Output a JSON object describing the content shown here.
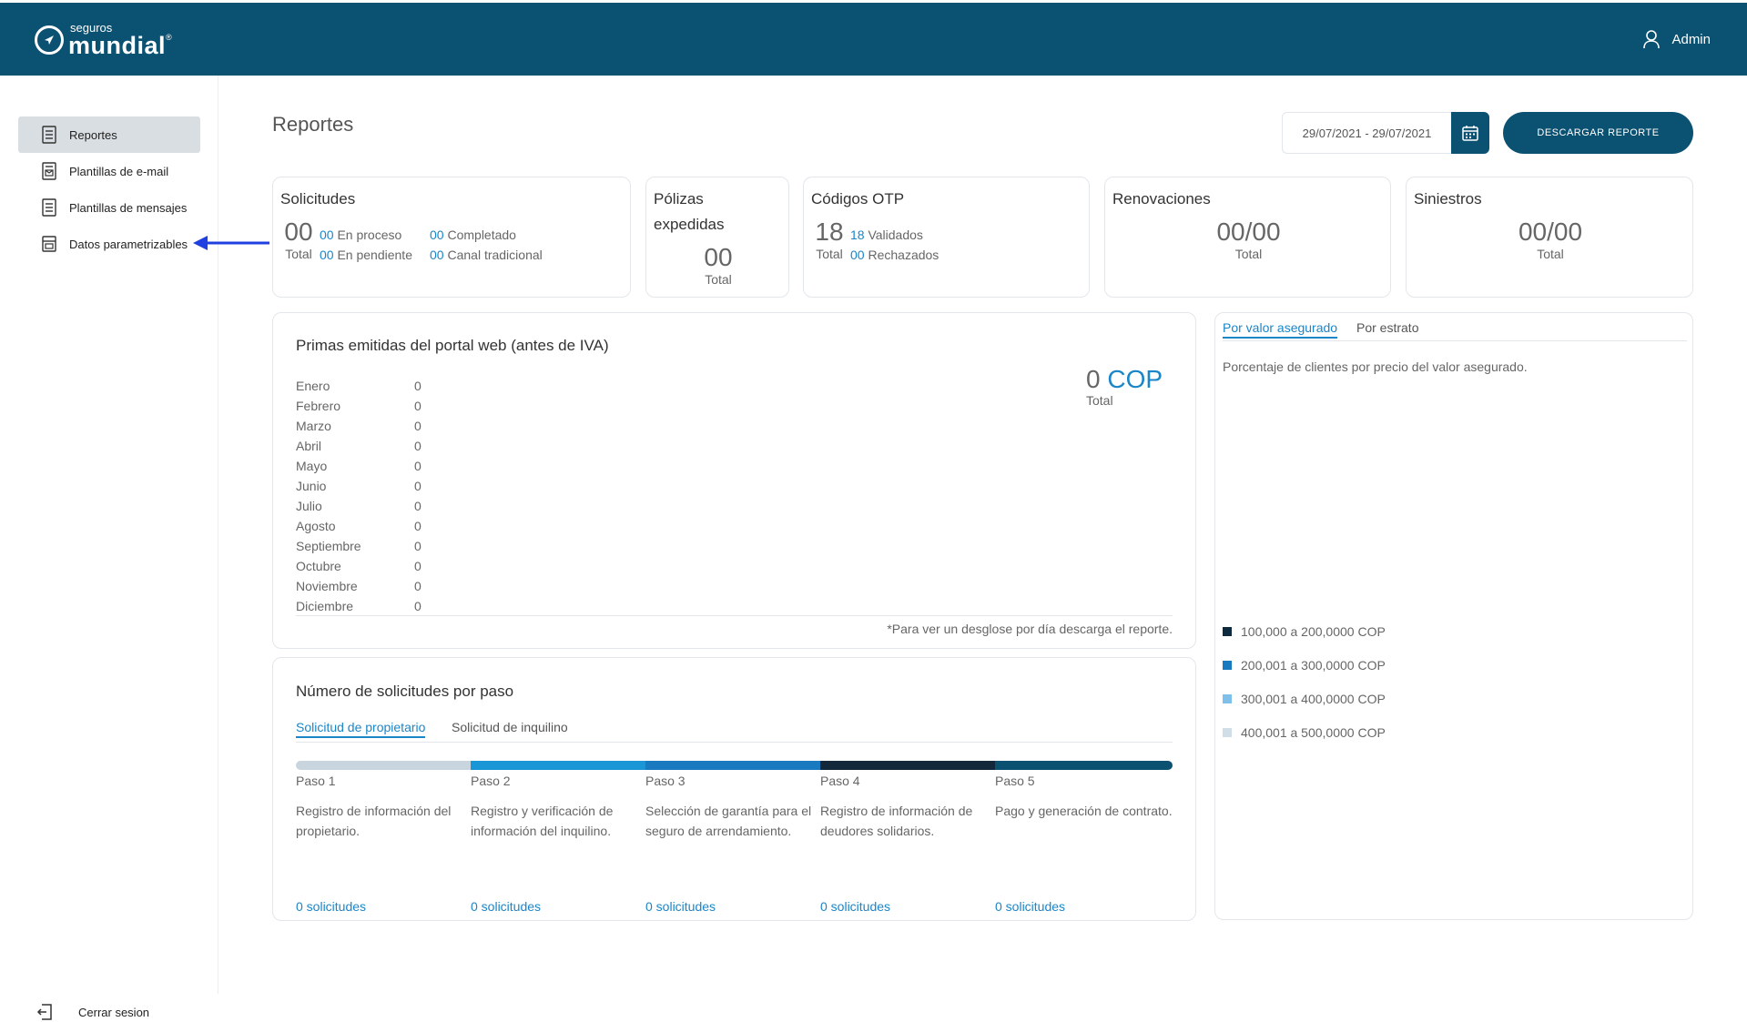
{
  "header": {
    "logo_small": "seguros",
    "logo_big": "mundial",
    "logo_reg": "®",
    "user": "Admin"
  },
  "sidebar": {
    "items": [
      {
        "label": "Reportes",
        "icon": "document-icon",
        "active": true
      },
      {
        "label": "Plantillas de e-mail",
        "icon": "email-template-icon",
        "active": false
      },
      {
        "label": "Plantillas de mensajes",
        "icon": "document-icon",
        "active": false
      },
      {
        "label": "Datos parametrizables",
        "icon": "data-icon",
        "active": false
      }
    ],
    "logout": "Cerrar sesion"
  },
  "main": {
    "title": "Reportes",
    "date_range": "29/07/2021 - 29/07/2021",
    "download_label": "DESCARGAR REPORTE"
  },
  "cards": {
    "solicitudes": {
      "title": "Solicitudes",
      "total_value": "00",
      "total_label": "Total",
      "proceso_value": "00",
      "proceso_label": "En proceso",
      "pendiente_value": "00",
      "pendiente_label": "En pendiente",
      "completado_value": "00",
      "completado_label": "Completado",
      "canal_value": "00",
      "canal_label": "Canal tradicional"
    },
    "polizas": {
      "title_line1": "Pólizas",
      "title_line2": "expedidas",
      "value": "00",
      "label": "Total"
    },
    "otp": {
      "title": "Códigos OTP",
      "total_value": "18",
      "total_label": "Total",
      "validados_value": "18",
      "validados_label": "Validados",
      "rechazados_value": "00",
      "rechazados_label": "Rechazados"
    },
    "renovaciones": {
      "title": "Renovaciones",
      "value": "00/00",
      "label": "Total"
    },
    "siniestros": {
      "title": "Siniestros",
      "value": "00/00",
      "label": "Total"
    }
  },
  "primas": {
    "title": "Primas emitidas del portal web (antes de IVA)",
    "total_value": "0",
    "total_currency": "COP",
    "total_label": "Total",
    "months": [
      {
        "name": "Enero",
        "value": "0"
      },
      {
        "name": "Febrero",
        "value": "0"
      },
      {
        "name": "Marzo",
        "value": "0"
      },
      {
        "name": "Abril",
        "value": "0"
      },
      {
        "name": "Mayo",
        "value": "0"
      },
      {
        "name": "Junio",
        "value": "0"
      },
      {
        "name": "Julio",
        "value": "0"
      },
      {
        "name": "Agosto",
        "value": "0"
      },
      {
        "name": "Septiembre",
        "value": "0"
      },
      {
        "name": "Octubre",
        "value": "0"
      },
      {
        "name": "Noviembre",
        "value": "0"
      },
      {
        "name": "Diciembre",
        "value": "0"
      }
    ],
    "footnote": "*Para ver un desglose por día descarga el reporte."
  },
  "clientes": {
    "tab_active": "Por valor asegurado",
    "tab_inactive": "Por estrato",
    "description": "Porcentaje de clientes por precio del valor asegurado.",
    "legend": [
      {
        "label": "100,000 a 200,0000 COP",
        "color": "#0e2a3e"
      },
      {
        "label": "200,001 a 300,0000 COP",
        "color": "#1a7ac0"
      },
      {
        "label": "300,001 a 400,0000 COP",
        "color": "#7fc0ea"
      },
      {
        "label": "400,001 a 500,0000 COP",
        "color": "#d2dee7"
      }
    ]
  },
  "pasos": {
    "title": "Número de solicitudes por paso",
    "tab_active": "Solicitud de propietario",
    "tab_inactive": "Solicitud de inquilino",
    "steps": [
      {
        "label": "Paso 1",
        "desc": "Registro de información del propietario.",
        "count": "0 solicitudes",
        "color": "#c8d5df"
      },
      {
        "label": "Paso 2",
        "desc": "Registro y verificación de información del inquilino.",
        "count": "0 solicitudes",
        "color": "#1a95d6"
      },
      {
        "label": "Paso 3",
        "desc": "Selección de garantía para el seguro de arrendamiento.",
        "count": "0 solicitudes",
        "color": "#1a7ac0"
      },
      {
        "label": "Paso 4",
        "desc": "Registro de información de deudores solidarios.",
        "count": "0 solicitudes",
        "color": "#13283a"
      },
      {
        "label": "Paso 5",
        "desc": "Pago y generación de contrato.",
        "count": "0 solicitudes",
        "color": "#0b5172"
      }
    ]
  }
}
